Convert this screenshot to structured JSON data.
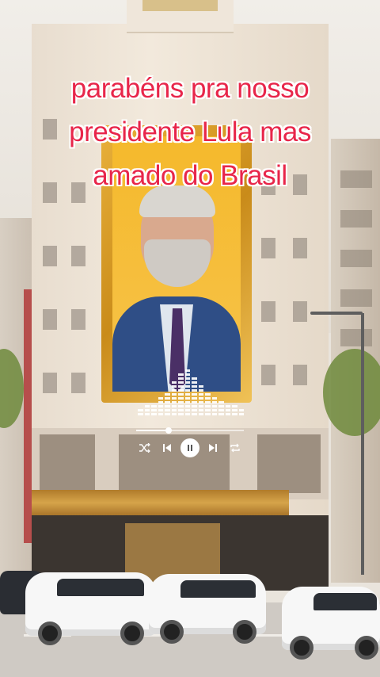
{
  "caption": {
    "lines": [
      "parabéns pra nosso",
      "presidente Lula mas",
      "amado do Brasil"
    ],
    "color": "#e8264a"
  },
  "music_player": {
    "progress": 0.3,
    "controls": [
      "shuffle-icon",
      "previous-icon",
      "pause-icon",
      "next-icon",
      "repeat-icon"
    ],
    "equalizer_levels": [
      2,
      3,
      3,
      5,
      6,
      9,
      11,
      12,
      10,
      8,
      6,
      5,
      4,
      3,
      3,
      2
    ]
  },
  "colors": {
    "caption_outline": "#ffffff",
    "frame_gold": "#e9b13b",
    "controls": "#ffffff"
  }
}
